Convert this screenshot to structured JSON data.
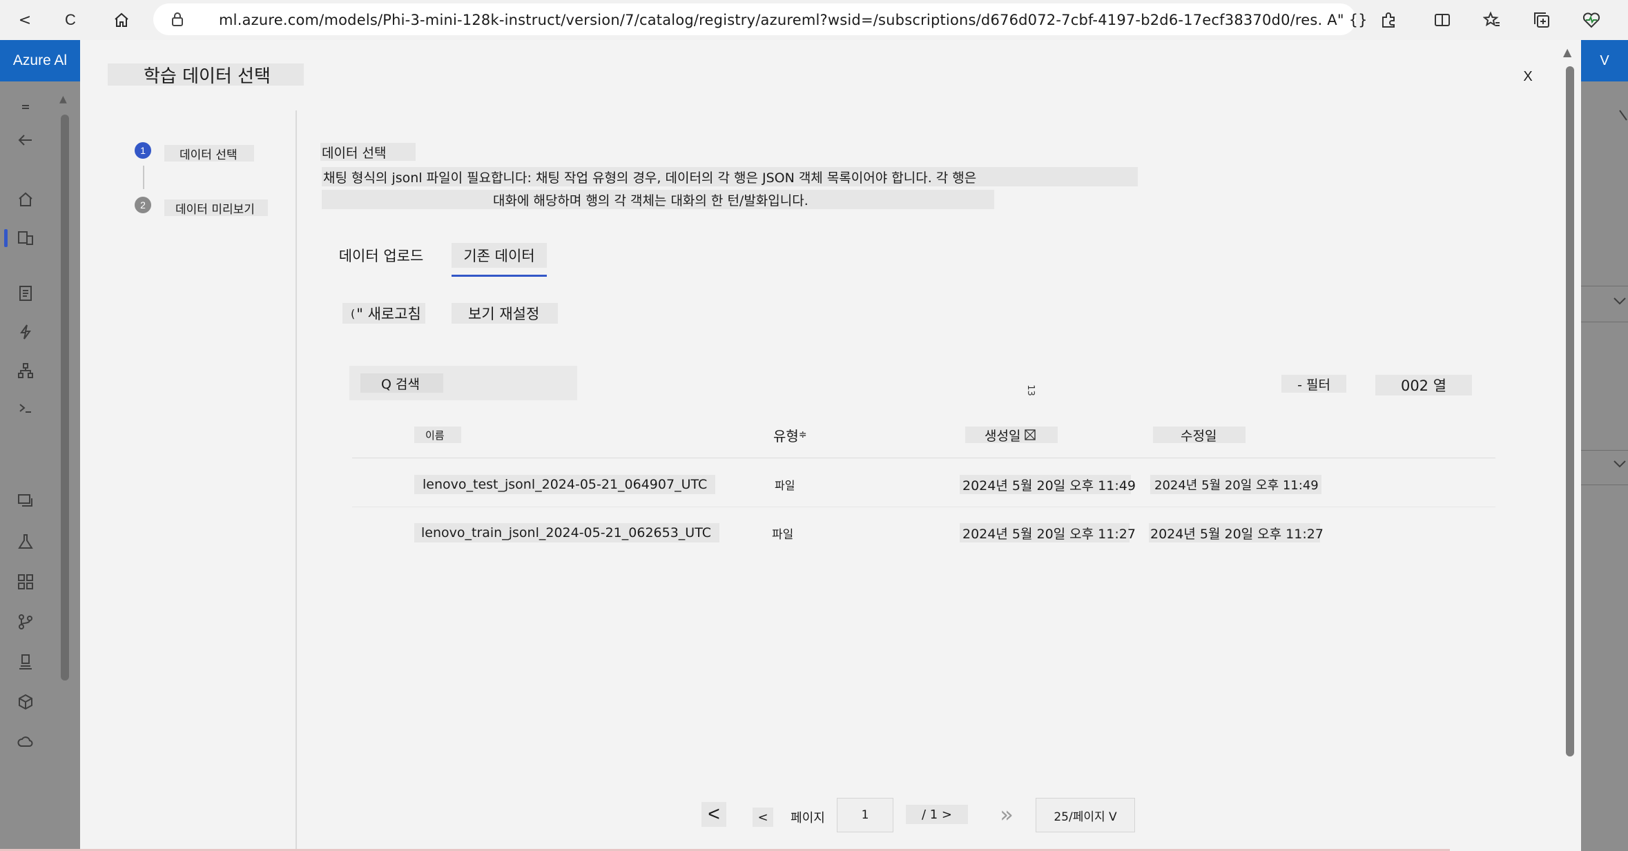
{
  "browser": {
    "url": "ml.azure.com/models/Phi-3-mini-128k-instruct/version/7/catalog/registry/azureml?wsid=/subscriptions/d676d072-7cbf-4197-b2d6-17ecf38370d0/res. A\" {}",
    "back_label": "<",
    "refresh_label": "C"
  },
  "azure": {
    "brand": "Azure Al",
    "right_button": "V"
  },
  "modal": {
    "title": "학습 데이터 선택",
    "close_label": "X",
    "steps": [
      {
        "number": "1",
        "label": "데이터 선택"
      },
      {
        "number": "2",
        "label": "데이터 미리보기"
      }
    ],
    "section_title": "데이터 선택",
    "description_line1": "채팅 형식의 jsonl 파일이 필요합니다: 채팅 작업 유형의 경우, 데이터의 각 행은 JSON 객체 목록이어야 합니다. 각 행은",
    "description_line2": "대화에 해당하며 행의 각 객체는 대화의 한 턴/발화입니다.",
    "tabs": [
      {
        "label": "데이터 업로드",
        "selected": false
      },
      {
        "label": "기존 데이터",
        "selected": true
      }
    ],
    "refresh_button": "\" 새로고침",
    "refresh_prefix": "(",
    "reset_view_button": "보기 재설정",
    "search_label": "Q 검색",
    "stray_mark": "13",
    "filter_button": "- 필터",
    "columns_button": "002 열",
    "table": {
      "headers": {
        "name": "이름",
        "type": "유형",
        "type_sort": "≑",
        "created": "생성일",
        "modified": "수정일"
      },
      "rows": [
        {
          "name": "lenovo_test_jsonl_2024-05-21_064907_UTC",
          "type": "파일",
          "created": "2024년 5월 20일 오후 11:49",
          "modified": "2024년 5월 20일 오후 11:49"
        },
        {
          "name": "lenovo_train_jsonl_2024-05-21_062653_UTC",
          "type": "파일",
          "created": "2024년 5월 20일 오후 11:27",
          "modified": "2024년 5월 20일 오후 11:27"
        }
      ]
    },
    "pagination": {
      "first_label": "<",
      "prev_label": "<",
      "page_label": "페이지",
      "page_value": "1",
      "total_label": "/ 1 >",
      "last_label": "»",
      "page_size": "25/페이지 V"
    }
  },
  "colors": {
    "accent": "#3357c7",
    "azure_blue": "#1666c0",
    "step_inactive": "#8a8a8a"
  }
}
